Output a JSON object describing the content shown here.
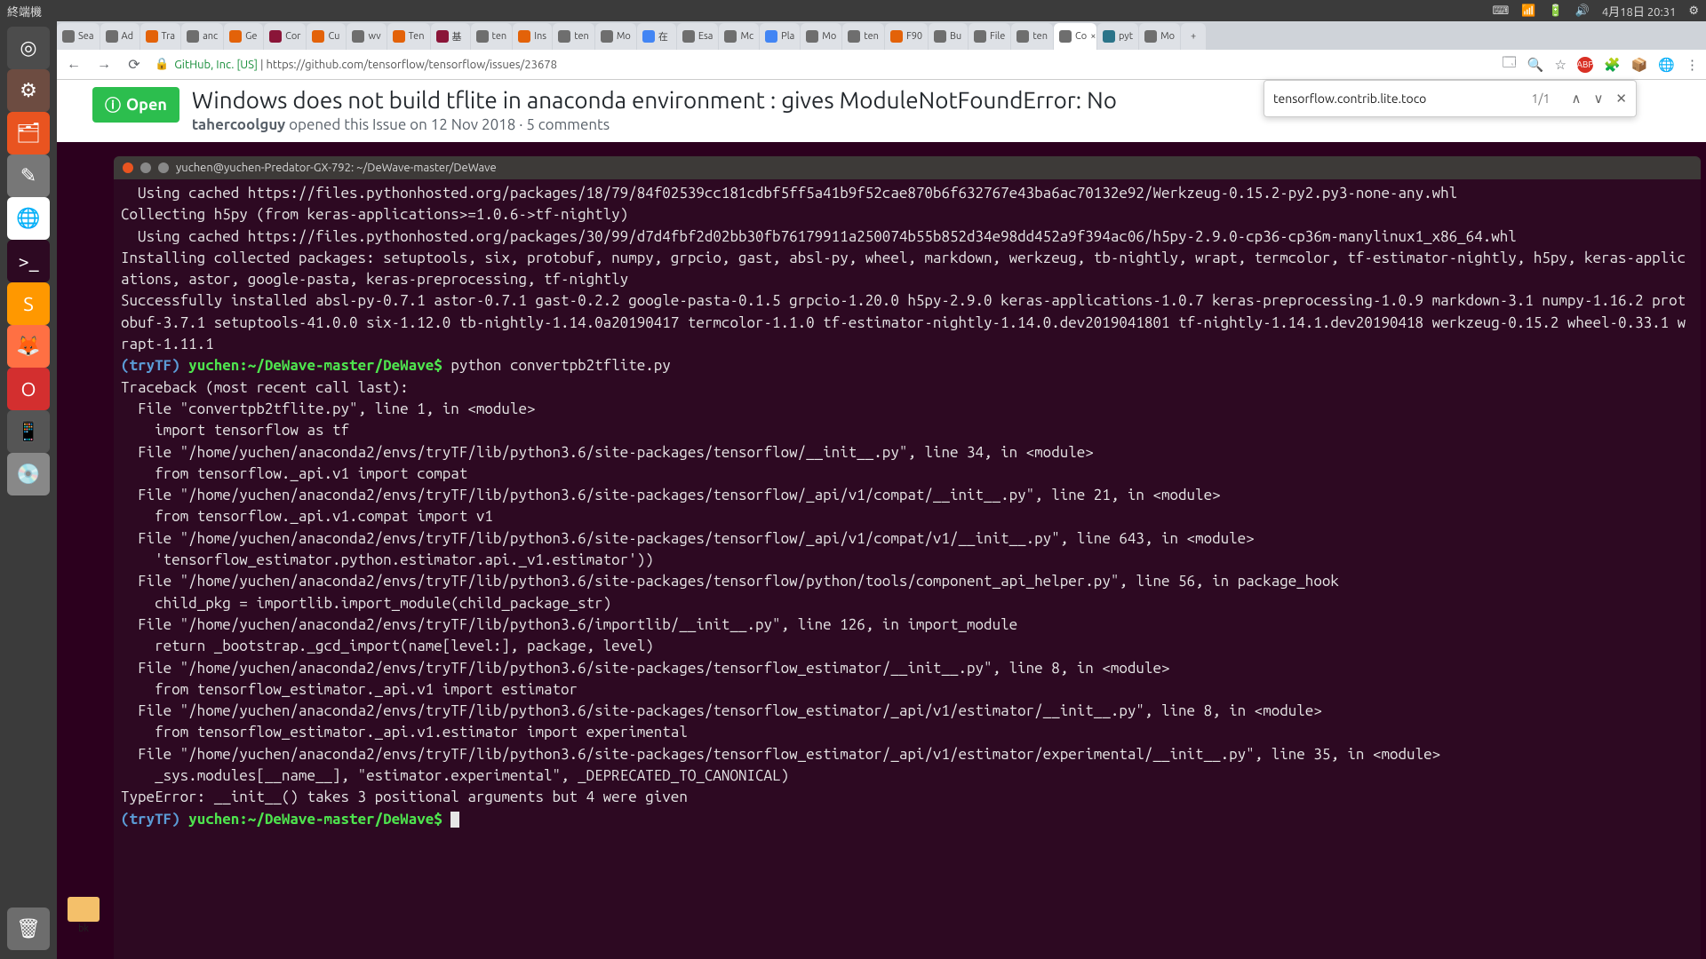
{
  "menubar": {
    "app": "終端機",
    "battery": "⏻",
    "volume": "🔊",
    "datetime": "4月18日 20:31",
    "gear": "⚙"
  },
  "browser": {
    "tabs": [
      {
        "fav": "#6e6e6e",
        "label": "Sea"
      },
      {
        "fav": "#6e6e6e",
        "label": "Ad"
      },
      {
        "fav": "#e36209",
        "label": "Tra"
      },
      {
        "fav": "#6e6e6e",
        "label": "anc"
      },
      {
        "fav": "#e36209",
        "label": "Ge"
      },
      {
        "fav": "#8a1538",
        "label": "Cor"
      },
      {
        "fav": "#e36209",
        "label": "Cu"
      },
      {
        "fav": "#6e6e6e",
        "label": "wv"
      },
      {
        "fav": "#e36209",
        "label": "Ten"
      },
      {
        "fav": "#8a1538",
        "label": "基"
      },
      {
        "fav": "#6e6e6e",
        "label": "ten"
      },
      {
        "fav": "#e36209",
        "label": "Ins"
      },
      {
        "fav": "#6e6e6e",
        "label": "ten"
      },
      {
        "fav": "#6e6e6e",
        "label": "Mo"
      },
      {
        "fav": "#4285f4",
        "label": "在"
      },
      {
        "fav": "#6e6e6e",
        "label": "Esa"
      },
      {
        "fav": "#6e6e6e",
        "label": "Mc"
      },
      {
        "fav": "#4285f4",
        "label": "Pla"
      },
      {
        "fav": "#6e6e6e",
        "label": "Mo"
      },
      {
        "fav": "#6e6e6e",
        "label": "ten"
      },
      {
        "fav": "#e36209",
        "label": "F90"
      },
      {
        "fav": "#6e6e6e",
        "label": "Bu"
      },
      {
        "fav": "#6e6e6e",
        "label": "File"
      },
      {
        "fav": "#6e6e6e",
        "label": "ten"
      },
      {
        "fav": "#6e6e6e",
        "label": "Co",
        "active": true
      },
      {
        "fav": "#2b7489",
        "label": "pyt"
      },
      {
        "fav": "#6e6e6e",
        "label": "Mo"
      }
    ],
    "host": "GitHub, Inc. [US]",
    "url": "https://github.com/tensorflow/tensorflow/issues/23678"
  },
  "issue": {
    "status": "Open",
    "title": "Windows does not build tflite in anaconda environment : gives ModuleNotFoundError: No",
    "author": "tahercoolguy",
    "opened": "opened this Issue on 12 Nov 2018 · 5 comments"
  },
  "find": {
    "query": "tensorflow.contrib.lite.toco",
    "count": "1/1"
  },
  "terminal": {
    "title": "yuchen@yuchen-Predator-GX-792: ~/DeWave-master/DeWave",
    "prompt_env": "(tryTF)",
    "prompt_path": "yuchen:~/DeWave-master/DeWave$",
    "cmd1": "python convertpb2tflite.py",
    "lines_top": "  Using cached https://files.pythonhosted.org/packages/18/79/84f02539cc181cdbf5ff5a41b9f52cae870b6f632767e43ba6ac70132e92/Werkzeug-0.15.2-py2.py3-none-any.whl\nCollecting h5py (from keras-applications>=1.0.6->tf-nightly)\n  Using cached https://files.pythonhosted.org/packages/30/99/d7d4fbf2d02bb30fb76179911a250074b55b852d34e98dd452a9f394ac06/h5py-2.9.0-cp36-cp36m-manylinux1_x86_64.whl\nInstalling collected packages: setuptools, six, protobuf, numpy, grpcio, gast, absl-py, wheel, markdown, werkzeug, tb-nightly, wrapt, termcolor, tf-estimator-nightly, h5py, keras-applications, astor, google-pasta, keras-preprocessing, tf-nightly\nSuccessfully installed absl-py-0.7.1 astor-0.7.1 gast-0.2.2 google-pasta-0.1.5 grpcio-1.20.0 h5py-2.9.0 keras-applications-1.0.7 keras-preprocessing-1.0.9 markdown-3.1 numpy-1.16.2 protobuf-3.7.1 setuptools-41.0.0 six-1.12.0 tb-nightly-1.14.0a20190417 termcolor-1.1.0 tf-estimator-nightly-1.14.0.dev2019041801 tf-nightly-1.14.1.dev20190418 werkzeug-0.15.2 wheel-0.33.1 wrapt-1.11.1",
    "traceback": "Traceback (most recent call last):\n  File \"convertpb2tflite.py\", line 1, in <module>\n    import tensorflow as tf\n  File \"/home/yuchen/anaconda2/envs/tryTF/lib/python3.6/site-packages/tensorflow/__init__.py\", line 34, in <module>\n    from tensorflow._api.v1 import compat\n  File \"/home/yuchen/anaconda2/envs/tryTF/lib/python3.6/site-packages/tensorflow/_api/v1/compat/__init__.py\", line 21, in <module>\n    from tensorflow._api.v1.compat import v1\n  File \"/home/yuchen/anaconda2/envs/tryTF/lib/python3.6/site-packages/tensorflow/_api/v1/compat/v1/__init__.py\", line 643, in <module>\n    'tensorflow_estimator.python.estimator.api._v1.estimator'))\n  File \"/home/yuchen/anaconda2/envs/tryTF/lib/python3.6/site-packages/tensorflow/python/tools/component_api_helper.py\", line 56, in package_hook\n    child_pkg = importlib.import_module(child_package_str)\n  File \"/home/yuchen/anaconda2/envs/tryTF/lib/python3.6/importlib/__init__.py\", line 126, in import_module\n    return _bootstrap._gcd_import(name[level:], package, level)\n  File \"/home/yuchen/anaconda2/envs/tryTF/lib/python3.6/site-packages/tensorflow_estimator/__init__.py\", line 8, in <module>\n    from tensorflow_estimator._api.v1 import estimator\n  File \"/home/yuchen/anaconda2/envs/tryTF/lib/python3.6/site-packages/tensorflow_estimator/_api/v1/estimator/__init__.py\", line 8, in <module>\n    from tensorflow_estimator._api.v1.estimator import experimental\n  File \"/home/yuchen/anaconda2/envs/tryTF/lib/python3.6/site-packages/tensorflow_estimator/_api/v1/estimator/experimental/__init__.py\", line 35, in <module>\n    _sys.modules[__name__], \"estimator.experimental\", _DEPRECATED_TO_CANONICAL)\nTypeError: __init__() takes 3 positional arguments but 4 were given"
  },
  "desktop": {
    "folder": "bk"
  },
  "launcher": [
    {
      "bg": "#4c4c4c",
      "glyph": "◎"
    },
    {
      "bg": "#6d4c41",
      "glyph": "⚙"
    },
    {
      "bg": "#e95420",
      "glyph": "🗂"
    },
    {
      "bg": "#777",
      "glyph": "✎"
    },
    {
      "bg": "#fff",
      "glyph": "🌐"
    },
    {
      "bg": "#2d0922",
      "glyph": ">_"
    },
    {
      "bg": "#ff9800",
      "glyph": "S"
    },
    {
      "bg": "#ff7043",
      "glyph": "🦊"
    },
    {
      "bg": "#d32f2f",
      "glyph": "O"
    },
    {
      "bg": "#555",
      "glyph": "📱"
    },
    {
      "bg": "#888",
      "glyph": "💿"
    }
  ]
}
